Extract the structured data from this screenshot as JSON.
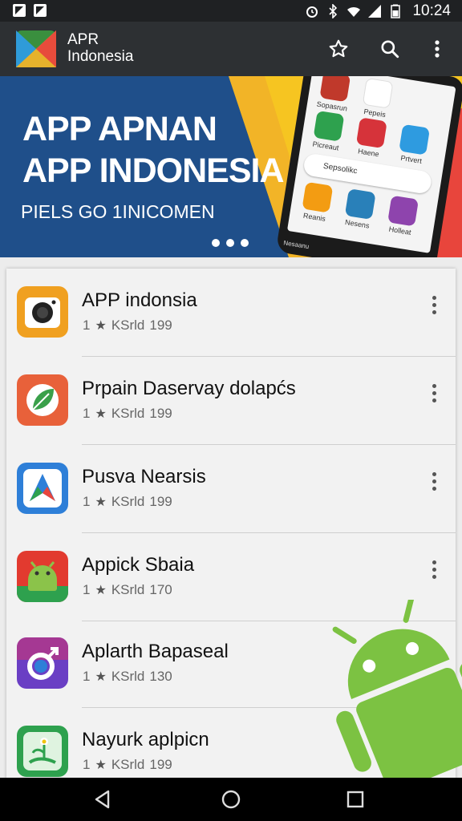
{
  "status_bar": {
    "time": "10:24",
    "icons": [
      "notification-icon",
      "download-icon",
      "alarm-icon",
      "bluetooth-icon",
      "wifi-icon",
      "signal-icon",
      "battery-icon"
    ]
  },
  "app_bar": {
    "title_line1": "APR",
    "title_line2": "Indonesia",
    "actions": [
      "star-icon",
      "search-icon",
      "more-vert-icon"
    ]
  },
  "banner": {
    "headline_line1": "APP APNAN",
    "headline_line2": "APP INDONESIA",
    "subtitle": "PIELS GO 1INICOMEN",
    "page_dots": 3,
    "phone": {
      "apps": [
        "Sopasrun",
        "Pepeis",
        "Picreaut",
        "Haene",
        "Prtvert",
        "Reanis",
        "Nesens",
        "Holleat"
      ],
      "search_text": "Sepsolikc",
      "nav_label": "Nesaanu"
    }
  },
  "apps": [
    {
      "name": "APP indonsia",
      "rating": "1",
      "store": "KSrld",
      "count": "199",
      "icon": "camera-icon",
      "color": "#f0a020"
    },
    {
      "name": "Prpain Daservay dolapćs",
      "rating": "1",
      "store": "KSrld",
      "count": "199",
      "icon": "leaf-icon",
      "color": "#e8613a"
    },
    {
      "name": "Pusva Nearsis",
      "rating": "1",
      "store": "KSrld",
      "count": "199",
      "icon": "navigation-icon",
      "color": "#2e7fd8"
    },
    {
      "name": "Appick Sbaia",
      "rating": "1",
      "store": "KSrld",
      "count": "170",
      "icon": "android-icon",
      "color": "#e23a2f"
    },
    {
      "name": "Aplarth Bapaseal",
      "rating": "1",
      "store": "KSrld",
      "count": "130",
      "icon": "gender-icon",
      "color": "#6a3fc4"
    },
    {
      "name": "Nayurk aplpicn",
      "rating": "1",
      "store": "KSrld",
      "count": "199",
      "icon": "flower-icon",
      "color": "#2ea14e"
    }
  ],
  "nav_bar": {
    "buttons": [
      "back-icon",
      "home-icon",
      "recents-icon"
    ]
  },
  "colors": {
    "app_bar": "#2d3033",
    "banner_blue": "#1f4f8a",
    "banner_yellow": "#f6c521",
    "banner_red": "#e8453c",
    "android_green": "#7cc242"
  }
}
